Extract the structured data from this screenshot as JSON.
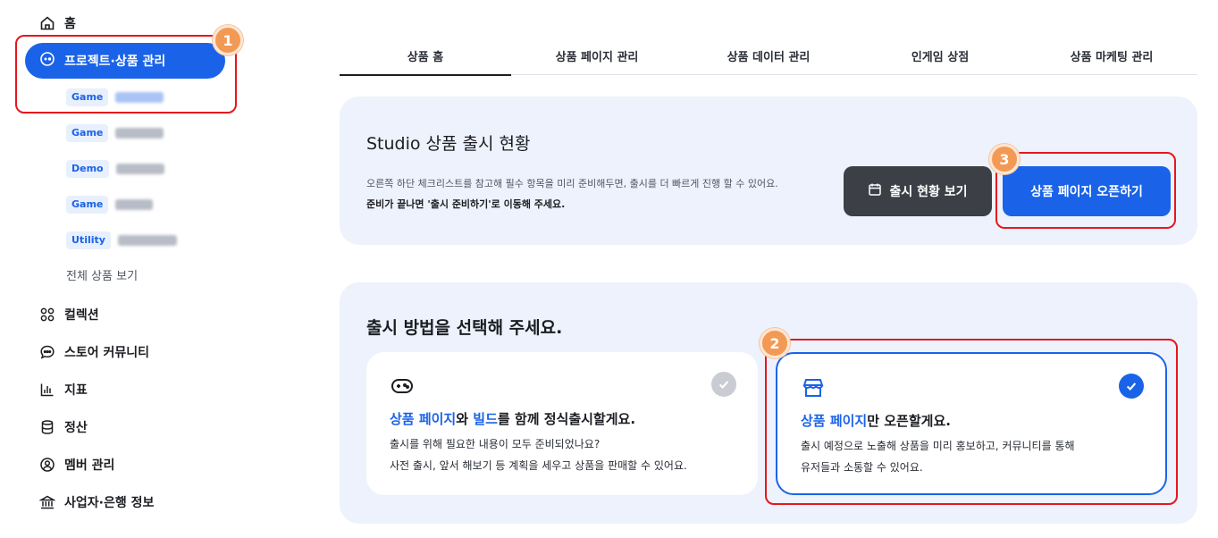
{
  "sidebar": {
    "home": "홈",
    "active": "프로젝트·상품 관리",
    "sub_items": [
      {
        "badge": "Game"
      },
      {
        "badge": "Game"
      },
      {
        "badge": "Demo"
      },
      {
        "badge": "Game"
      },
      {
        "badge": "Utility"
      }
    ],
    "all_products": "전체 상품 보기",
    "menu": [
      {
        "label": "컬렉션",
        "icon": "collection-icon"
      },
      {
        "label": "스토어 커뮤니티",
        "icon": "chat-icon"
      },
      {
        "label": "지표",
        "icon": "chart-icon"
      },
      {
        "label": "정산",
        "icon": "database-icon"
      },
      {
        "label": "멤버 관리",
        "icon": "member-icon"
      },
      {
        "label": "사업자·은행 정보",
        "icon": "bank-icon"
      }
    ]
  },
  "tabs": [
    "상품 홈",
    "상품 페이지 관리",
    "상품 데이터 관리",
    "인게임 상점",
    "상품 마케팅 관리"
  ],
  "status": {
    "title": "Studio 상품 출시 현황",
    "desc1": "오른쪽 하단 체크리스트를 참고해 필수 항목을 미리 준비해두면, 출시를 더 빠르게 진행 할 수 있어요.",
    "desc2": "준비가 끝나면 '출시 준비하기'로 이동해 주세요.",
    "btn_view": "출시 현황 보기",
    "btn_open": "상품 페이지 오픈하기"
  },
  "method": {
    "title": "출시 방법을 선택해 주세요.",
    "option_full": {
      "acc1": "상품 페이지",
      "mid1": "와 ",
      "acc2": "빌드",
      "rest": "를 함께 정식출시할게요.",
      "line1": "출시를 위해 필요한 내용이 모두 준비되었나요?",
      "line2": "사전 출시, 앞서 해보기 등 계획을 세우고 상품을 판매할 수 있어요."
    },
    "option_page": {
      "acc": "상품 페이지",
      "rest": "만 오픈할게요.",
      "line1": "출시 예정으로 노출해 상품을 미리 홍보하고, 커뮤니티를 통해",
      "line2": "유저들과 소통할 수 있어요."
    }
  },
  "markers": [
    "1",
    "2",
    "3"
  ],
  "colors": {
    "accent": "#1a63e8",
    "highlight": "#e5171d",
    "marker": "#f29a55"
  }
}
